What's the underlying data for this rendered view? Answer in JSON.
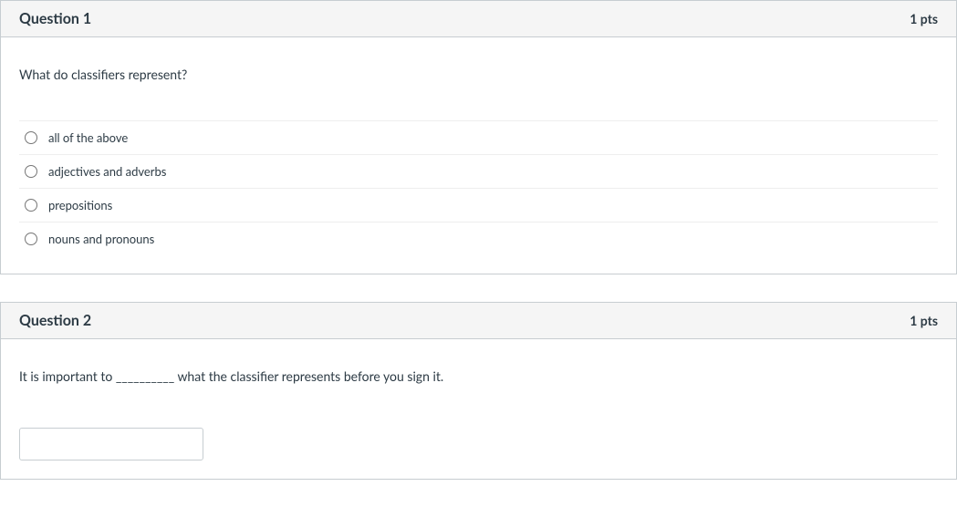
{
  "questions": [
    {
      "title": "Question 1",
      "points": "1 pts",
      "prompt": "What do classifiers represent?",
      "type": "multiple_choice",
      "options": [
        "all of the above",
        "adjectives and adverbs",
        "prepositions",
        "nouns and pronouns"
      ]
    },
    {
      "title": "Question 2",
      "points": "1 pts",
      "prompt": "It is important to __________ what the classifier represents before you sign it.",
      "type": "short_answer",
      "answer_value": ""
    }
  ]
}
